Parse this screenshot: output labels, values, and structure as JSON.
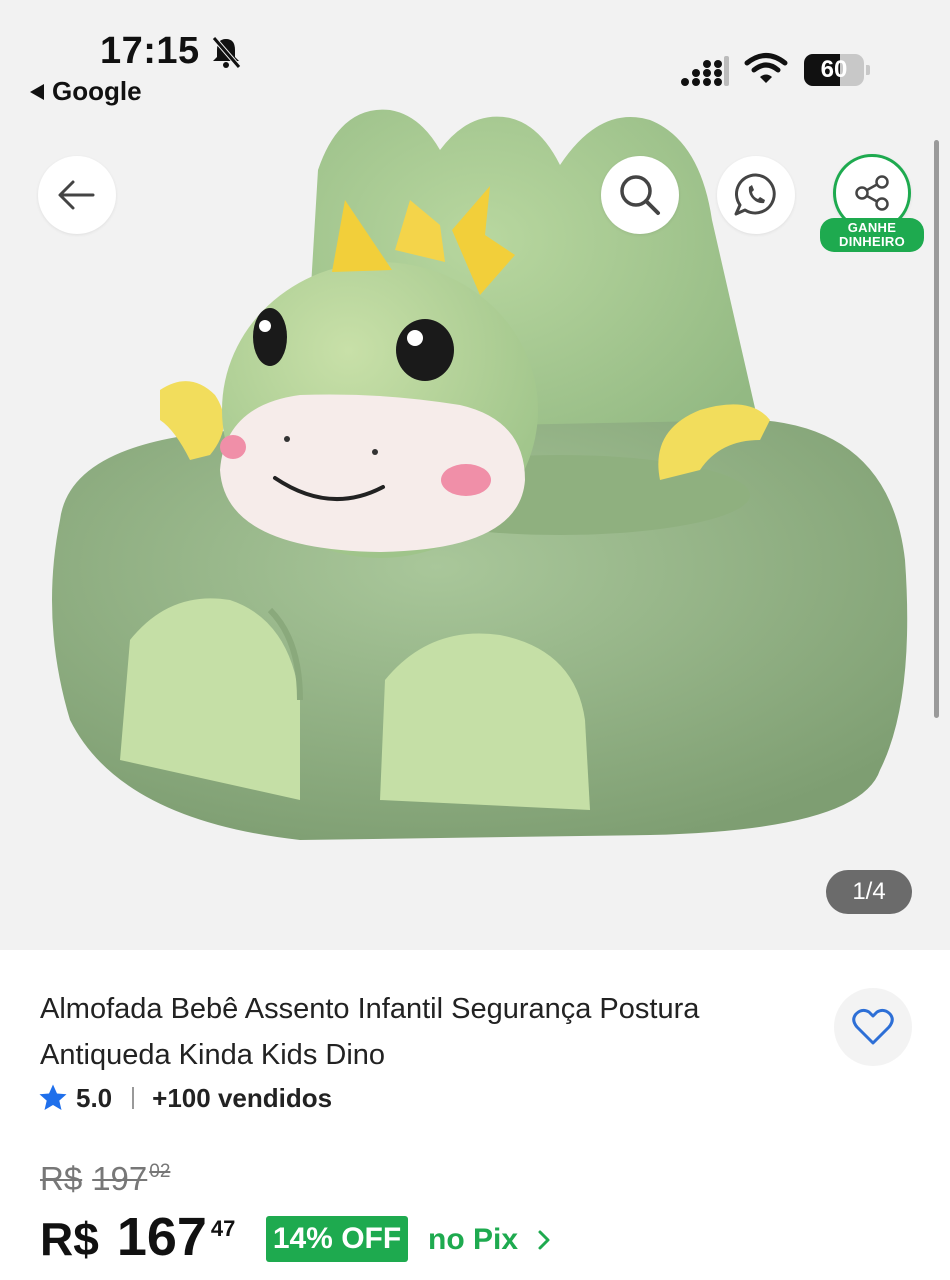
{
  "status_bar": {
    "time": "17:15",
    "back_app": "Google",
    "battery": "60",
    "battery_level": 0.6
  },
  "gallery": {
    "counter": "1/4",
    "current": 1,
    "total": 4,
    "share_badge_line1": "GANHE",
    "share_badge_line2": "DINHEIRO"
  },
  "product": {
    "title": "Almofada Bebê Assento Infantil Segurança Postura Antiqueda Kinda Kids Dino",
    "rating": "5.0",
    "sold": "+100 vendidos"
  },
  "pricing": {
    "old_currency": "R$",
    "old_whole": "197",
    "old_cents": "02",
    "currency": "R$",
    "whole": "167",
    "cents": "47",
    "discount": "14% OFF",
    "payment": "no Pix"
  },
  "colors": {
    "accent_green": "#1eaa4f",
    "star_blue": "#1f6feb",
    "heart_blue": "#2d6fd6"
  },
  "icons": [
    "back-arrow-icon",
    "search-icon",
    "whatsapp-icon",
    "share-icon",
    "heart-icon",
    "star-icon",
    "chevron-right-icon",
    "bell-slash-icon",
    "signal-icon",
    "wifi-icon"
  ]
}
